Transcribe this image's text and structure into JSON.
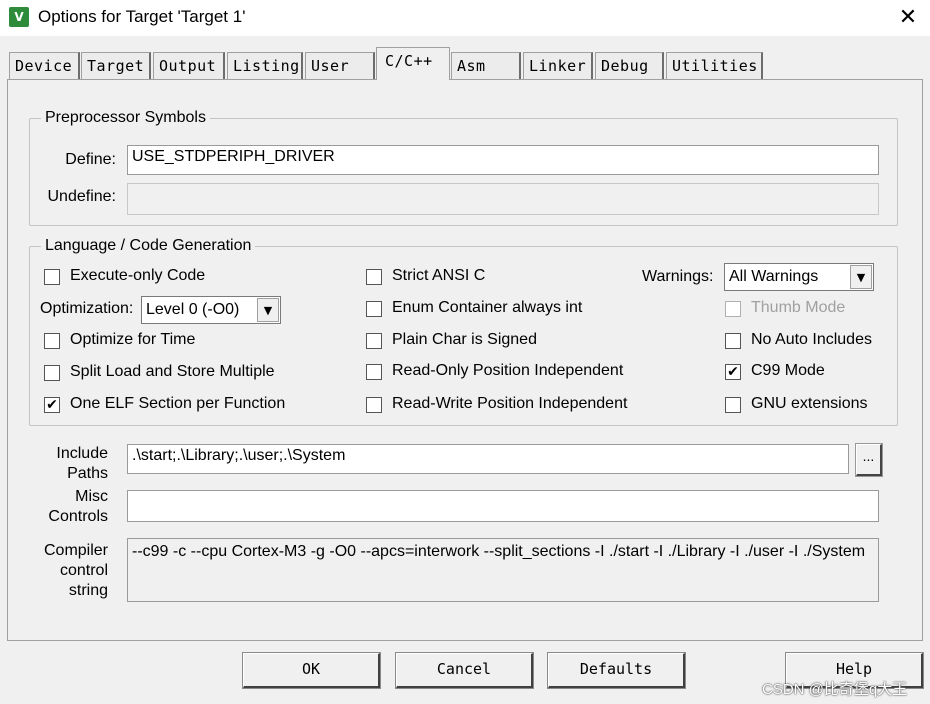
{
  "window": {
    "title": "Options for Target 'Target 1'",
    "close_glyph": "✕",
    "icon": "keil-uvision-icon"
  },
  "tabs": [
    {
      "label": "Device"
    },
    {
      "label": "Target"
    },
    {
      "label": "Output"
    },
    {
      "label": "Listing"
    },
    {
      "label": "User"
    },
    {
      "label": "C/C++",
      "active": true
    },
    {
      "label": "Asm"
    },
    {
      "label": "Linker"
    },
    {
      "label": "Debug"
    },
    {
      "label": "Utilities"
    }
  ],
  "preprocessor": {
    "title": "Preprocessor Symbols",
    "define_label": "Define:",
    "define_value": "USE_STDPERIPH_DRIVER",
    "undefine_label": "Undefine:",
    "undefine_value": ""
  },
  "codegen": {
    "title": "Language / Code Generation",
    "execute_only": {
      "label": "Execute-only Code",
      "checked": false
    },
    "optimization_label": "Optimization:",
    "optimization_value": "Level 0 (-O0)",
    "optimize_time": {
      "label": "Optimize for Time",
      "checked": false
    },
    "split_load": {
      "label": "Split Load and Store Multiple",
      "checked": false
    },
    "one_elf": {
      "label": "One ELF Section per Function",
      "checked": true
    },
    "strict_ansi": {
      "label": "Strict ANSI C",
      "checked": false
    },
    "enum_container": {
      "label": "Enum Container always int",
      "checked": false
    },
    "plain_char": {
      "label": "Plain Char is Signed",
      "checked": false
    },
    "ro_pi": {
      "label": "Read-Only Position Independent",
      "checked": false
    },
    "rw_pi": {
      "label": "Read-Write Position Independent",
      "checked": false
    },
    "warnings_label": "Warnings:",
    "warnings_value": "All Warnings",
    "thumb_mode": {
      "label": "Thumb Mode",
      "checked": false,
      "disabled": true
    },
    "no_auto_includes": {
      "label": "No Auto Includes",
      "checked": false
    },
    "c99_mode": {
      "label": "C99 Mode",
      "checked": true
    },
    "gnu_ext": {
      "label": "GNU extensions",
      "checked": false
    }
  },
  "include": {
    "label_line1": "Include",
    "label_line2": "Paths",
    "value": ".\\start;.\\Library;.\\user;.\\System",
    "browse_label": "..."
  },
  "misc": {
    "label_line1": "Misc",
    "label_line2": "Controls",
    "value": ""
  },
  "compiler": {
    "label_line1": "Compiler",
    "label_line2": "control",
    "label_line3": "string",
    "value": "--c99 -c --cpu Cortex-M3 -g -O0 --apcs=interwork --split_sections -I ./start -I ./Library -I ./user -I ./System"
  },
  "buttons": {
    "ok": "OK",
    "cancel": "Cancel",
    "defaults": "Defaults",
    "help": "Help"
  },
  "watermark": "CSDN @比奇堡q大王",
  "check_glyph": "✔",
  "dropdown_glyph": "▼"
}
